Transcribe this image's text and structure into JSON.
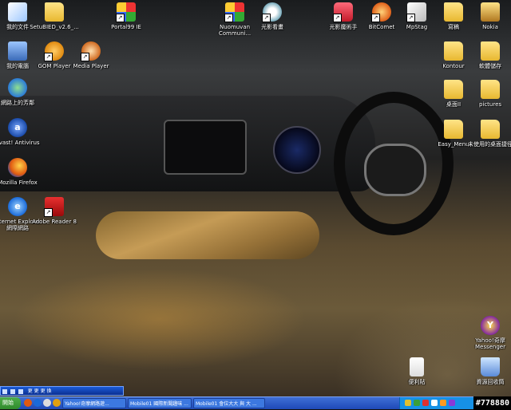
{
  "desktop_icons": {
    "my_documents": "我的文件",
    "setup_file": "SetuBIED_v2.6_...",
    "portal": "Portal99 IE",
    "nuomuvan": "Nuomuvan Communi...",
    "guangying_kanhua": "光影看畫",
    "guangying_mofa": "光影魔術手",
    "bitcomet": "BitComet",
    "mpstag": "MpStag",
    "folder_tr1": "寫稿",
    "nokia": "Nokia",
    "my_computer": "我的電腦",
    "gom_player": "GOM Player",
    "media_player": "Media Player",
    "kontour": "Kontour",
    "folder_tr2": "軟體儲存",
    "network": "網路上的芳鄰",
    "desktop_folder": "桌面II",
    "pictures": "pictures",
    "avast": "avast! Antivirus",
    "easy_menu": "Easy_Menu",
    "unused_shortcuts": "未使用的桌面捷徑",
    "firefox": "Mozilla Firefox",
    "ie": "Internet Explorer 網際網路",
    "adobe_reader": "Adobe Reader 8",
    "yahoo_messenger": "Yahoo!奇摩 Messenger",
    "notepad": "便利貼",
    "recycle_bin": "資源回收筒"
  },
  "taskbar": {
    "start_label": "開始",
    "tasks": [
      "Yahoo!奇摩網路遊...",
      "Mobile01 國際新聞趣味 ...",
      "Mobile01 會位大大 與 大 ..."
    ],
    "clock": "#778880"
  },
  "media_bar": {
    "title": "更 更 更 換"
  },
  "colors": {
    "taskbar": "#1e49b6",
    "start": "#2e8a2c",
    "tray": "#1691e6"
  }
}
